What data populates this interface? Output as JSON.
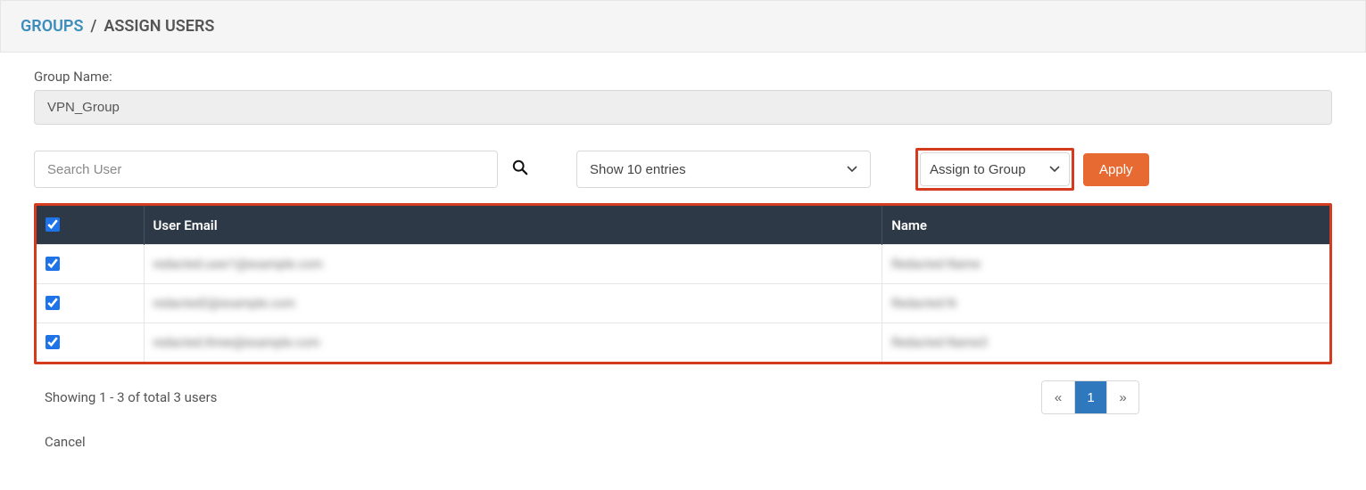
{
  "breadcrumb": {
    "link": "GROUPS",
    "sep": "/",
    "current": "ASSIGN USERS"
  },
  "group": {
    "label": "Group Name:",
    "value": "VPN_Group"
  },
  "search": {
    "placeholder": "Search User"
  },
  "entries": {
    "selected": "Show 10 entries"
  },
  "assign": {
    "selected": "Assign to Group"
  },
  "apply_label": "Apply",
  "table": {
    "headers": {
      "email": "User Email",
      "name": "Name"
    },
    "rows": [
      {
        "checked": true,
        "email": "redacted.user1@example.com",
        "name": "Redacted Name"
      },
      {
        "checked": true,
        "email": "redacted2@example.com",
        "name": "Redacted N"
      },
      {
        "checked": true,
        "email": "redacted.three@example.com",
        "name": "Redacted Name3"
      }
    ],
    "select_all": true
  },
  "footer": {
    "showing": "Showing 1 - 3 of total 3 users",
    "prev": "«",
    "page": "1",
    "next": "»"
  },
  "cancel_label": "Cancel"
}
